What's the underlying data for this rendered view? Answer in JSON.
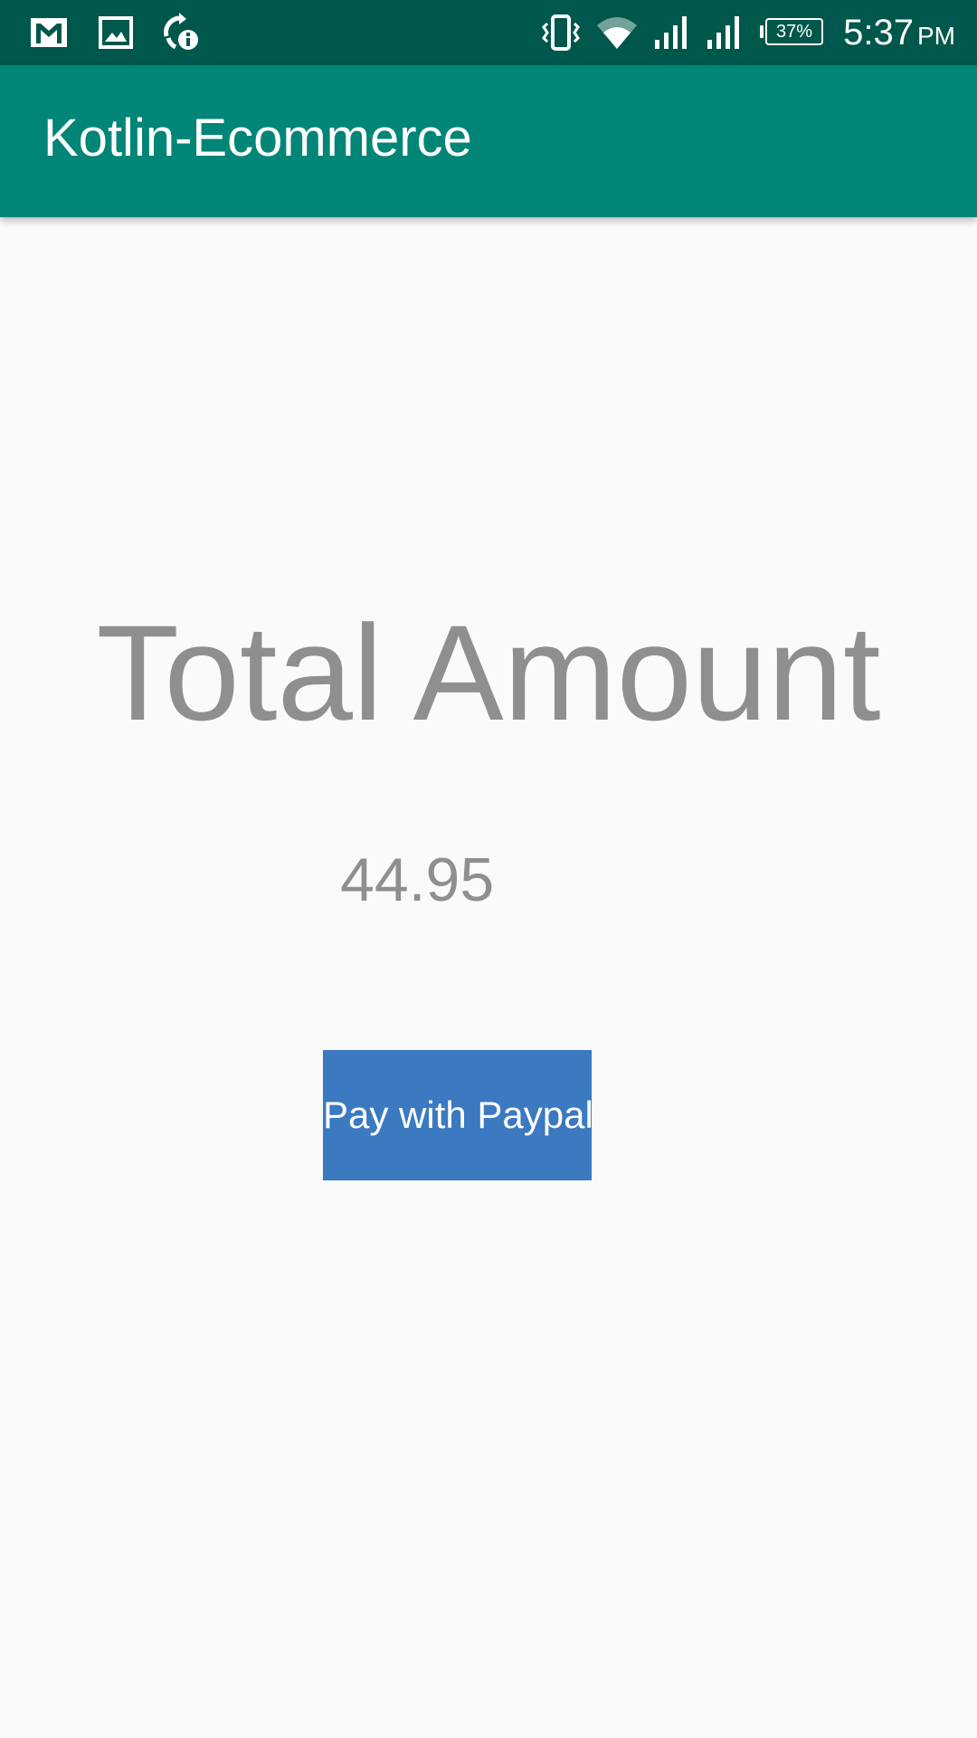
{
  "status_bar": {
    "icons_left": [
      "gmail-icon",
      "gallery-icon",
      "sync-info-icon"
    ],
    "icons_right": [
      "vibrate-icon",
      "wifi-icon",
      "signal-icon",
      "signal-icon"
    ],
    "battery": "37%",
    "time": "5:37",
    "ampm": "PM"
  },
  "app_bar": {
    "title": "Kotlin-Ecommerce"
  },
  "main": {
    "total_label": "Total Amount",
    "amount": "44.95",
    "pay_button_label": "Pay with Paypal"
  },
  "colors": {
    "status_bar": "#00574b",
    "app_bar": "#008577",
    "button": "#3b79c1",
    "text_gray": "#8f8f8f",
    "background": "#fafafa"
  }
}
